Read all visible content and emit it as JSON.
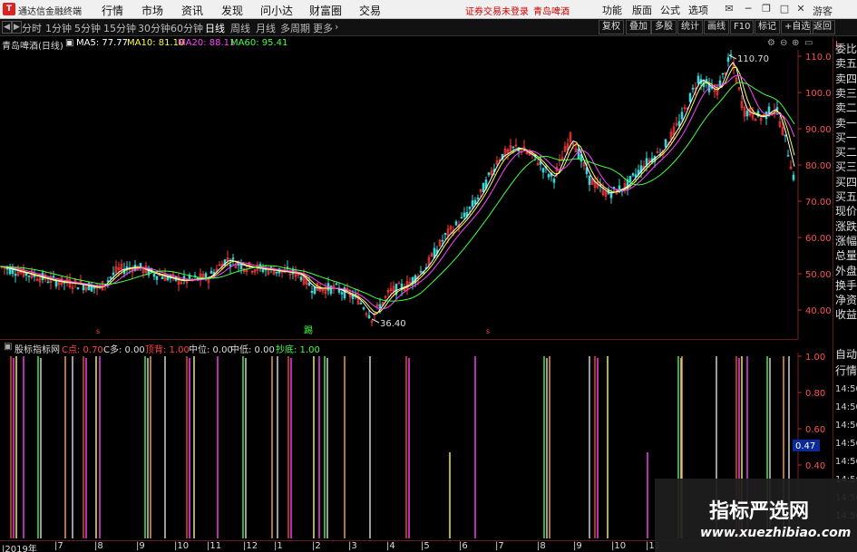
{
  "window": {
    "app_title": "通达信金融终端",
    "menu": [
      "行情",
      "市场",
      "资讯",
      "发现",
      "问小达",
      "财富圈",
      "交易"
    ],
    "login_status": "证券交易未登录",
    "stock_tag": "青岛啤酒",
    "tools": [
      "功能",
      "版面",
      "公式",
      "选项"
    ],
    "user_label": "游客"
  },
  "period_bar": {
    "periods": [
      "分时",
      "1分钟",
      "5分钟",
      "15分钟",
      "30分钟",
      "60分钟",
      "日线",
      "周线",
      "月线",
      "多周期",
      "更多"
    ],
    "active_period": "日线",
    "right_tools": [
      "复权",
      "叠加",
      "多股",
      "统计",
      "画线",
      "F10",
      "标记",
      "+自选",
      "返回"
    ]
  },
  "main_header": {
    "stock_name": "青岛啤酒(日线)",
    "indicators": [
      {
        "label": "MA5: 77.77",
        "color": "#ffffff"
      },
      {
        "label": "MA10: 81.10",
        "color": "#ffff44"
      },
      {
        "label": "MA20: 88.11",
        "color": "#ff44ff"
      },
      {
        "label": "MA60: 95.41",
        "color": "#44ff44"
      }
    ]
  },
  "price_axis": [
    "110.0",
    "100.0",
    "90.00",
    "80.00",
    "70.00",
    "60.00",
    "50.00",
    "40.00"
  ],
  "price_annotations": {
    "high": "110.70",
    "low": "36.40"
  },
  "event_marker": "踢",
  "indicator_header": {
    "name": "股标指标网",
    "fields": [
      {
        "label": "C点: 0.70",
        "color": "#ff4444"
      },
      {
        "label": "C多: 0.00",
        "color": "#dddddd"
      },
      {
        "label": "顶背: 1.00",
        "color": "#ff4444"
      },
      {
        "label": "中位: 0.00",
        "color": "#dddddd"
      },
      {
        "label": "中低: 0.00",
        "color": "#dddddd"
      },
      {
        "label": "抄底: 1.00",
        "color": "#44ff44"
      }
    ]
  },
  "sub_axis": [
    "1.00",
    "0.80",
    "0.60",
    "0.40"
  ],
  "sub_value_badge": "0.47",
  "side_panel": {
    "quote_items": [
      "委比",
      "卖五",
      "卖四",
      "卖三",
      "卖二",
      "卖一",
      "买一",
      "买二",
      "买三",
      "买四",
      "买五",
      "现价",
      "涨跌",
      "涨幅",
      "总量",
      "外盘",
      "换手",
      "净资",
      "收益"
    ],
    "tick_items": [
      "自动",
      "行情"
    ],
    "times": [
      "14:50",
      "14:50",
      "14:56",
      "14:56",
      "14:56",
      "14:56",
      "14:56",
      "14:56"
    ]
  },
  "time_axis": [
    "2019年",
    "7",
    "8",
    "9",
    "10",
    "11",
    "12",
    "1",
    "2",
    "3",
    "4",
    "5",
    "6",
    "7",
    "8",
    "9",
    "10",
    "11"
  ],
  "watermark": {
    "title": "指标严选网",
    "url": "www.xuezhibiao.com"
  }
}
